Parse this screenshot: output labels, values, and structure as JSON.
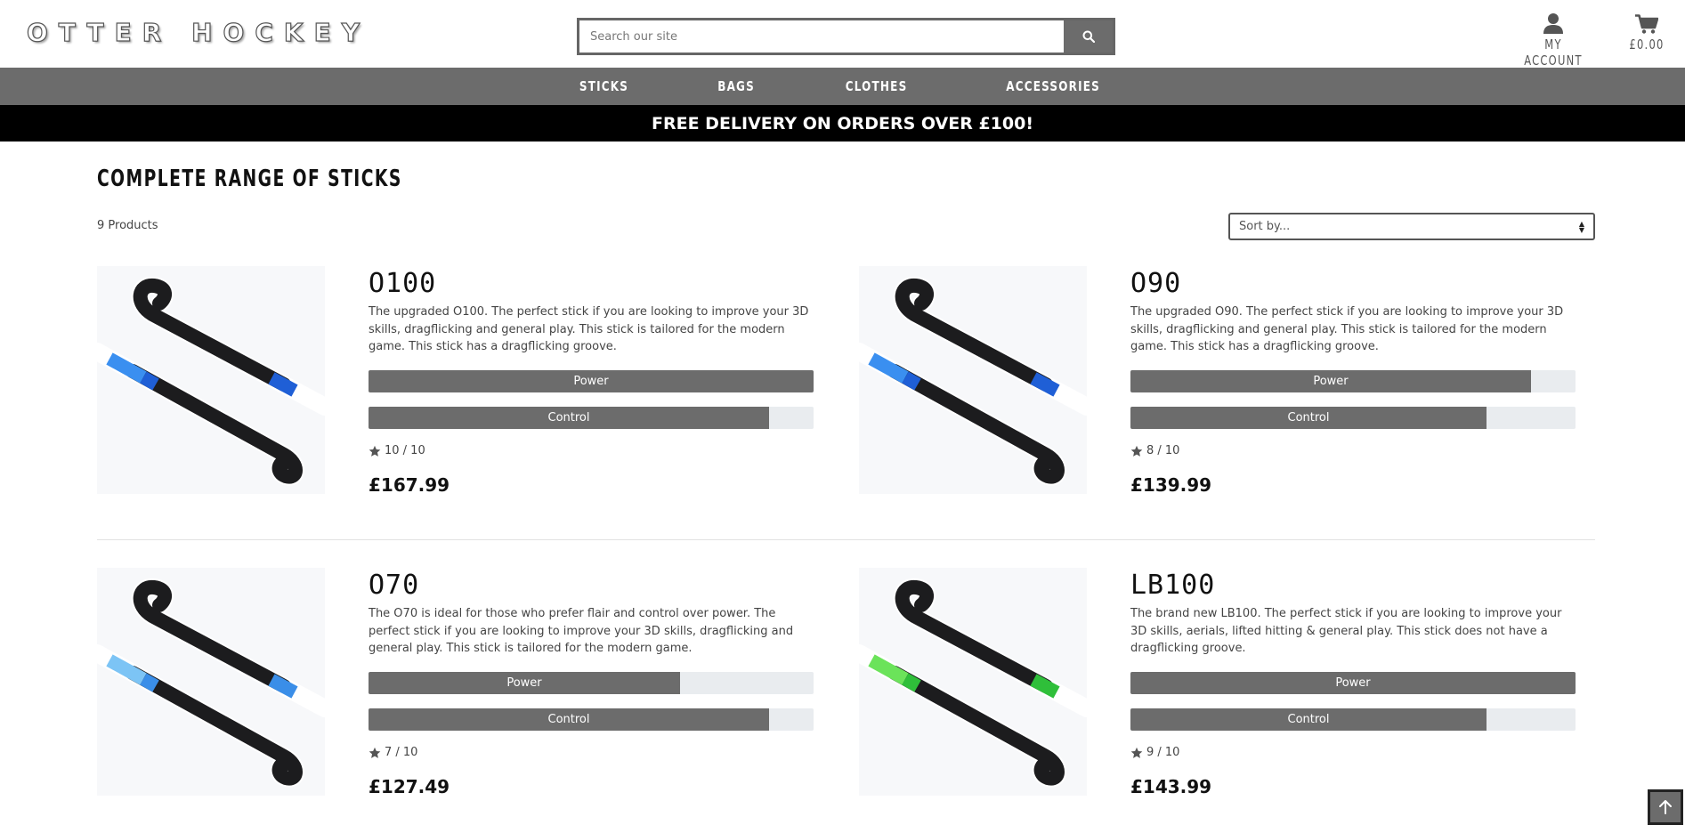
{
  "header": {
    "logo": "OTTER HOCKEY",
    "search_placeholder": "Search our site",
    "account_label": "MY ACCOUNT",
    "cart_total": "£0.00"
  },
  "nav": {
    "items": [
      "STICKS",
      "BAGS",
      "CLOTHES",
      "ACCESSORIES"
    ]
  },
  "banner": {
    "text": "FREE DELIVERY ON ORDERS OVER £100!"
  },
  "main": {
    "title": "COMPLETE RANGE OF STICKS",
    "product_count": "9 Products",
    "sort_placeholder": "Sort by..."
  },
  "products": [
    {
      "name": "O100",
      "description": "The upgraded O100. The perfect stick if you are looking to improve your 3D skills, dragflicking and general play. This stick is tailored for the modern game. This stick has a dragflicking groove.",
      "power_label": "Power",
      "power": 100,
      "control_label": "Control",
      "control": 90,
      "rating": "10 / 10",
      "price": "£167.99",
      "accent": "#1f5fd6",
      "accent_light": "#3a8ff0"
    },
    {
      "name": "O90",
      "description": "The upgraded O90. The perfect stick if you are looking to improve your 3D skills, dragflicking and general play. This stick is tailored for the modern game. This stick has a dragflicking groove.",
      "power_label": "Power",
      "power": 90,
      "control_label": "Control",
      "control": 80,
      "rating": "8 / 10",
      "price": "£139.99",
      "accent": "#1f5fd6",
      "accent_light": "#3a8ff0"
    },
    {
      "name": "O70",
      "description": "The O70 is ideal for those who prefer flair and control over power. The perfect stick if you are looking to improve your 3D skills, dragflicking and general play. This stick is tailored for the modern game.",
      "power_label": "Power",
      "power": 70,
      "control_label": "Control",
      "control": 90,
      "rating": "7 / 10",
      "price": "£127.49",
      "accent": "#3a8ee8",
      "accent_light": "#7cc4f5"
    },
    {
      "name": "LB100",
      "description": "The brand new LB100. The perfect stick if you are looking to improve your 3D skills, aerials, lifted hitting & general play. This stick does not have a dragflicking groove.",
      "power_label": "Power",
      "power": 100,
      "control_label": "Control",
      "control": 80,
      "rating": "9 / 10",
      "price": "£143.99",
      "accent": "#2fbf3a",
      "accent_light": "#6be35a"
    }
  ],
  "back_to_top": "back-to-top"
}
